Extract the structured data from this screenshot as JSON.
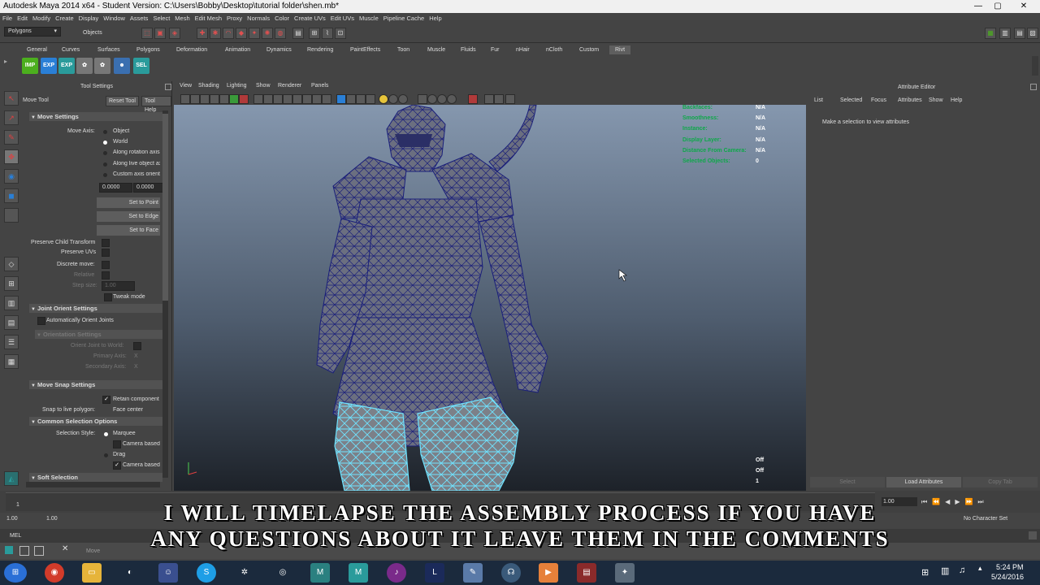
{
  "window": {
    "title": "Autodesk Maya 2014 x64 - Student Version: C:\\Users\\Bobby\\Desktop\\tutorial folder\\shen.mb*",
    "minimize": "—",
    "maximize": "▢",
    "close": "✕"
  },
  "menubar": [
    "File",
    "Edit",
    "Modify",
    "Create",
    "Display",
    "Window",
    "Assets",
    "Select",
    "Mesh",
    "Edit Mesh",
    "Proxy",
    "Normals",
    "Color",
    "Create UVs",
    "Edit UVs",
    "Muscle",
    "Pipeline Cache",
    "Help"
  ],
  "statusline": {
    "mode": "Polygons",
    "selection_mask": "Objects"
  },
  "shelf": {
    "tabs": [
      "General",
      "Curves",
      "Surfaces",
      "Polygons",
      "Deformation",
      "Animation",
      "Dynamics",
      "Rendering",
      "PaintEffects",
      "Toon",
      "Muscle",
      "Fluids",
      "Fur",
      "nHair",
      "nCloth",
      "Custom",
      "Rivt"
    ],
    "active_tab": "Rivt",
    "buttons": [
      {
        "label": "IMP",
        "color": "#4caf1e"
      },
      {
        "label": "EXP",
        "color": "#2a7fd6"
      },
      {
        "label": "EXP",
        "color": "#2a9b9b"
      },
      {
        "label": "SEL",
        "color": "#2a9b9b"
      }
    ]
  },
  "tool_settings": {
    "title": "Tool Settings",
    "tool_name": "Move Tool",
    "reset_button": "Reset Tool",
    "help_button": "Tool Help",
    "move_settings": {
      "header": "Move Settings",
      "axis_label": "Move Axis:",
      "axis_options": [
        "Object",
        "World",
        "Along rotation axis",
        "Along live object axis",
        "Custom axis orientation"
      ],
      "selected_axis": "World",
      "values": [
        "0.0000",
        "0.0000"
      ],
      "set_buttons": [
        "Set to Point",
        "Set to Edge",
        "Set to Face"
      ],
      "preserve_child": "Preserve Child Transform",
      "preserve_uvs": "Preserve UVs",
      "discrete_move": "Discrete move:",
      "relative": "Relative",
      "step_size": "Step size:",
      "step_value": "1.00",
      "tweak_mode": "Tweak mode"
    },
    "joint_orient": {
      "header": "Joint Orient Settings",
      "auto_orient": "Automatically Orient Joints",
      "orientation_header": "Orientation Settings",
      "orient_to_world": "Orient Joint to World:",
      "primary_axis": "Primary Axis:",
      "secondary_axis": "Secondary Axis:",
      "axis_value": "X"
    },
    "move_snap": {
      "header": "Move Snap Settings",
      "retain": "Retain component spacing",
      "snap_label": "Snap to live polygon:",
      "snap_value": "Face center"
    },
    "common_selection": {
      "header": "Common Selection Options",
      "style_label": "Selection Style:",
      "marquee": "Marquee",
      "camera_based_1": "Camera based selection",
      "drag": "Drag",
      "camera_based_2": "Camera based paint selection"
    },
    "soft_selection": {
      "header": "Soft Selection"
    }
  },
  "viewport": {
    "menu": [
      "View",
      "Shading",
      "Lighting",
      "Show",
      "Renderer",
      "Panels"
    ],
    "hud_top": [
      {
        "label": "Backfaces:",
        "value": "N/A"
      },
      {
        "label": "Smoothness:",
        "value": "N/A"
      },
      {
        "label": "Instance:",
        "value": "N/A"
      },
      {
        "label": "Display Layer:",
        "value": "N/A"
      },
      {
        "label": "Distance From Camera:",
        "value": "N/A"
      },
      {
        "label": "Selected Objects:",
        "value": "0"
      }
    ],
    "hud_bottom_values": [
      "Off",
      "Off",
      "1"
    ]
  },
  "attribute_editor": {
    "title": "Attribute Editor",
    "menu": [
      "List",
      "Selected",
      "Focus",
      "Attributes",
      "Show",
      "Help"
    ],
    "message": "Make a selection to view attributes",
    "buttons": [
      "Select",
      "Load Attributes",
      "Copy Tab"
    ]
  },
  "timeslider": {
    "current_frame": "1",
    "end_field": "1.00"
  },
  "rangeslider": {
    "start": "1.00",
    "start2": "1.00",
    "char_set": "No Character Set"
  },
  "cmdline": {
    "label": "MEL"
  },
  "helpline": {
    "text": "Move"
  },
  "subtitle": {
    "line1": "I WILL TIMELAPSE THE ASSEMBLY PROCESS IF YOU HAVE",
    "line2": "ANY QUESTIONS ABOUT IT LEAVE  THEM IN THE COMMENTS"
  },
  "taskbar": {
    "time": "5:24 PM",
    "date": "5/24/2016"
  },
  "colors": {
    "wireframe_selected": "#6fe3ff",
    "wireframe_default": "#1a1f7a",
    "hud_green": "#0fa84a",
    "taskbar": "#1b2a3d"
  }
}
